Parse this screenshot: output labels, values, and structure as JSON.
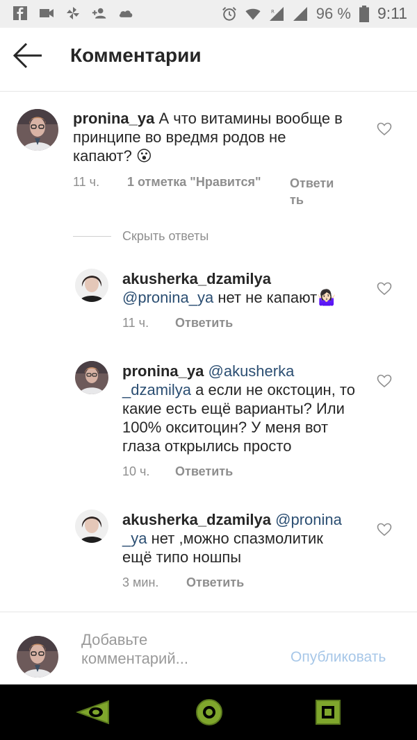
{
  "status": {
    "battery": "96 %",
    "time": "9:11"
  },
  "header": {
    "title": "Комментарии"
  },
  "comments": [
    {
      "user": "pronina_ya",
      "text": "А что витамины вообще в принципе во вредмя  родов не капают? 😮",
      "time": "11 ч.",
      "likes": "1 отметка \"Нравится\"",
      "reply_line1": "Ответи",
      "reply_line2": "ть"
    }
  ],
  "hide_replies": "Скрыть ответы",
  "replies": [
    {
      "user": "akusherka_dzamilya",
      "mention": "@pronina_ya",
      "text": "нет не капают🤷🏻‍♀️",
      "time": "11 ч.",
      "reply": "Ответить"
    },
    {
      "user": "pronina_ya",
      "mention": "@akusherka _dzamilya",
      "text": "а если не окстоцин, то какие есть ещё варианты? Или 100% окситоцин? У меня вот глаза открылись просто",
      "time": "10 ч.",
      "reply": "Ответить"
    },
    {
      "user": "akusherka_dzamilya",
      "mention": "@pronina _ya",
      "text": "нет ,можно спазмолитик ещё типо ношпы",
      "time": "3 мин.",
      "reply": "Ответить"
    }
  ],
  "composer": {
    "placeholder": "Добавьте комментарий...",
    "publish": "Опубликовать"
  },
  "icons": {
    "back": "arrow-left-icon",
    "heart": "heart-outline-icon",
    "nav_back": "triangle-back-icon",
    "nav_home": "circle-home-icon",
    "nav_recent": "square-recent-icon"
  }
}
